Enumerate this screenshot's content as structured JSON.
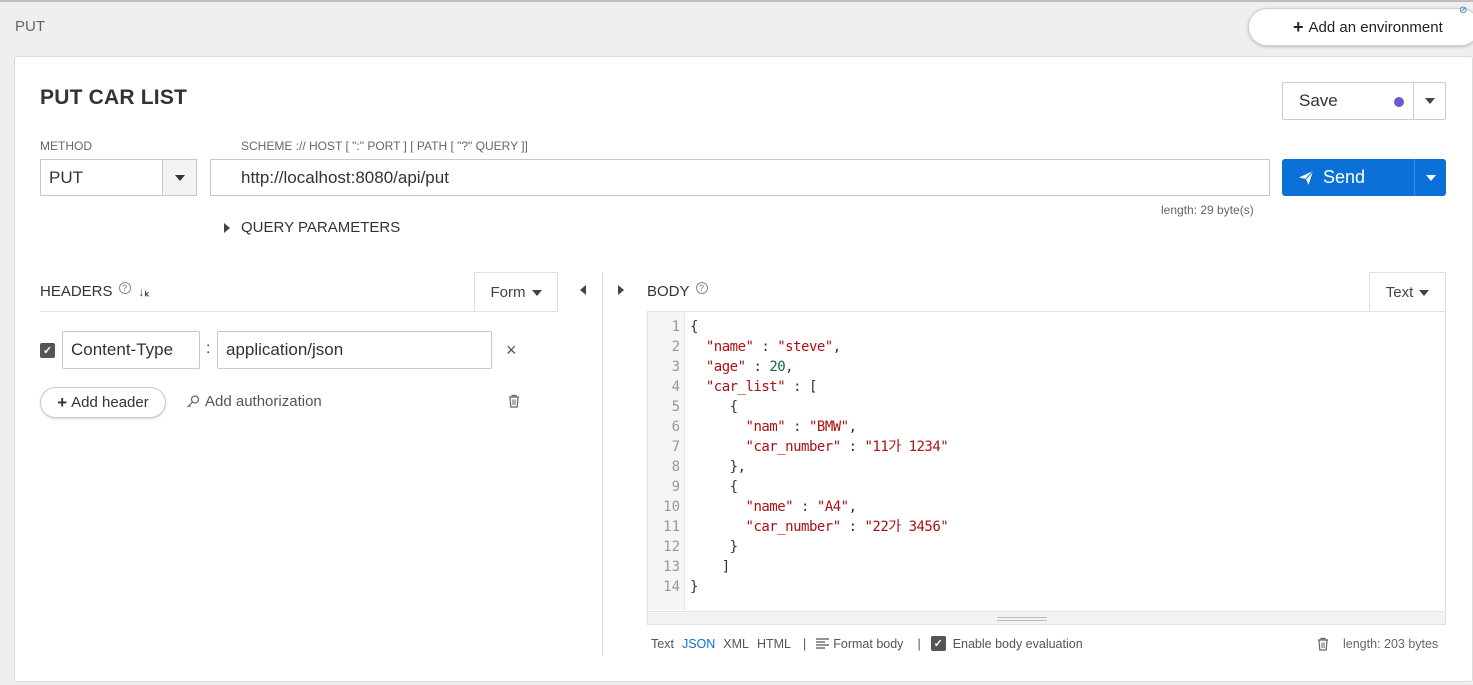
{
  "breadcrumb": "PUT",
  "env_button": "Add an environment",
  "corner_mark": "⊘",
  "request": {
    "title": "PUT CAR LIST",
    "save_label": "Save",
    "method_label": "METHOD",
    "method_value": "PUT",
    "url_label": "SCHEME :// HOST [ \":\" PORT ] [ PATH [ \"?\" QUERY ]]",
    "url_value": "http://localhost:8080/api/put",
    "url_length": "length: 29 byte(s)",
    "send_label": "Send",
    "query_parameters": "QUERY PARAMETERS"
  },
  "headers": {
    "title": "HEADERS",
    "mode": "Form",
    "rows": [
      {
        "name": "Content-Type",
        "value": "application/json",
        "enabled": true
      }
    ],
    "add_header": "Add header",
    "add_authorization": "Add authorization"
  },
  "body": {
    "title": "BODY",
    "mode": "Text",
    "lines": [
      "1",
      "2",
      "3",
      "4",
      "5",
      "6",
      "7",
      "8",
      "9",
      "10",
      "11",
      "12",
      "13",
      "14"
    ],
    "footer": {
      "text": "Text",
      "json": "JSON",
      "xml": "XML",
      "html": "HTML",
      "separator": "|",
      "format_body": "Format body",
      "enable_eval": "Enable body evaluation",
      "length": "length: 203 bytes"
    }
  },
  "colors": {
    "accent": "#0b71d9",
    "save_dot": "#6a5acd",
    "string": "#aa1111",
    "number": "#116644"
  }
}
